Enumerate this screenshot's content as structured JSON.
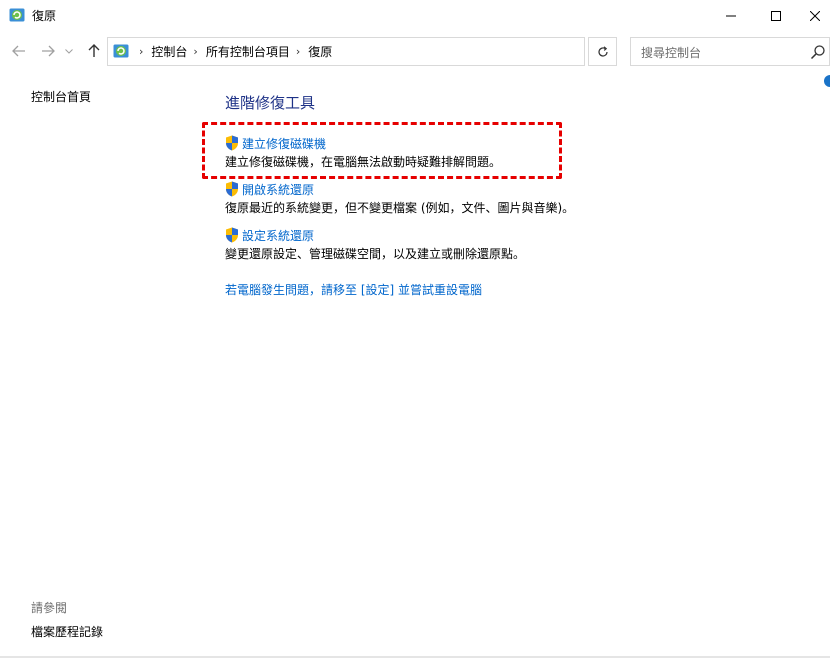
{
  "window": {
    "title": "復原",
    "controls": {
      "minimize": "minimize-icon",
      "maximize": "maximize-icon",
      "close": "close-icon"
    }
  },
  "nav": {
    "icons": {
      "back": "back-arrow-icon",
      "forward": "forward-arrow-icon",
      "recent": "chevron-down-icon",
      "up": "up-arrow-icon"
    },
    "breadcrumbs": [
      "控制台",
      "所有控制台項目",
      "復原"
    ],
    "search_placeholder": "搜尋控制台"
  },
  "left_pane": {
    "home": "控制台首頁",
    "see_also": "請參閱",
    "file_history": "檔案歷程記錄"
  },
  "main": {
    "heading": "進階修復工具",
    "tools": [
      {
        "label": "建立修復磁碟機",
        "description": "建立修復磁碟機，在電腦無法啟動時疑難排解問題。"
      },
      {
        "label": "開啟系統還原",
        "description": "復原最近的系統變更，但不變更檔案 (例如，文件、圖片與音樂)。"
      },
      {
        "label": "設定系統還原",
        "description": "變更還原設定、管理磁碟空間，以及建立或刪除還原點。"
      }
    ],
    "reset_link": "若電腦發生問題，請移至 [設定] 並嘗試重設電腦"
  },
  "colors": {
    "link": "#0066cc",
    "heading": "#1e3287",
    "highlight": "#e60000"
  }
}
